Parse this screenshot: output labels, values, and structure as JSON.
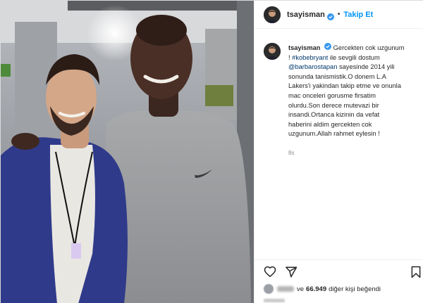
{
  "header": {
    "username": "tsayisman",
    "separator": "•",
    "follow_label": "Takip Et"
  },
  "caption": {
    "username": "tsayisman",
    "line1_text": "Gercekten cok uzgunum",
    "line2_prefix": "! ",
    "hashtag": "#kobebryant",
    "line2_suffix": " ile sevgili dostum",
    "mention": "@barbarostapan",
    "line3_suffix": " sayesinde 2014 yili",
    "line4": "sonunda tanismistik.O donem L.A",
    "line5": "Lakers'i yakindan takip etme ve onunla",
    "line6": "mac onceleri gorusme firsatim",
    "line7": "olurdu.Son derece mutevazi bir",
    "line8": "insandi.Ortanca kizinin da vefat",
    "line9": "haberini aldim gercekten cok",
    "line10": "uzgunum.Allah rahmet eylesin !",
    "time": "8s"
  },
  "likes": {
    "prefix": "ve",
    "count": "66.949",
    "suffix": "diğer kişi beğendi"
  },
  "icons": {
    "like": "heart-icon",
    "share": "send-icon",
    "save": "bookmark-icon",
    "verified": "verified-badge-icon"
  },
  "colors": {
    "link_blue": "#0095f6",
    "tag_blue": "#00376b",
    "verified_blue": "#3897f0",
    "text": "#262626",
    "muted": "#8e8e8e",
    "border": "#dbdbdb"
  }
}
